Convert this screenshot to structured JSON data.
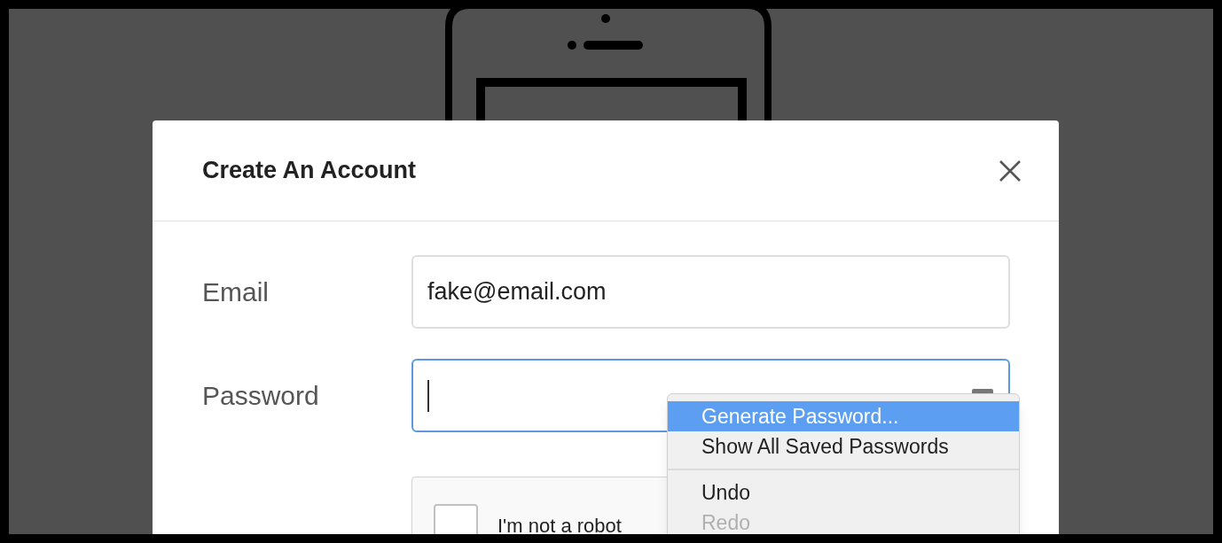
{
  "dialog": {
    "title": "Create An Account",
    "fields": [
      {
        "label": "Email",
        "value": "fake@email.com",
        "focused": false,
        "password_key": false
      },
      {
        "label": "Password",
        "focused": true,
        "password_key": true
      }
    ],
    "captcha": {
      "label": "I'm not a robot",
      "checked": false
    }
  },
  "context_menu": {
    "sections": [
      [
        {
          "label": "Generate Password...",
          "selected": true,
          "disabled": false
        },
        {
          "label": "Show All Saved Passwords",
          "selected": false,
          "disabled": false
        }
      ],
      [
        {
          "label": "Undo",
          "selected": false,
          "disabled": false
        },
        {
          "label": "Redo",
          "selected": false,
          "disabled": true
        }
      ]
    ]
  }
}
